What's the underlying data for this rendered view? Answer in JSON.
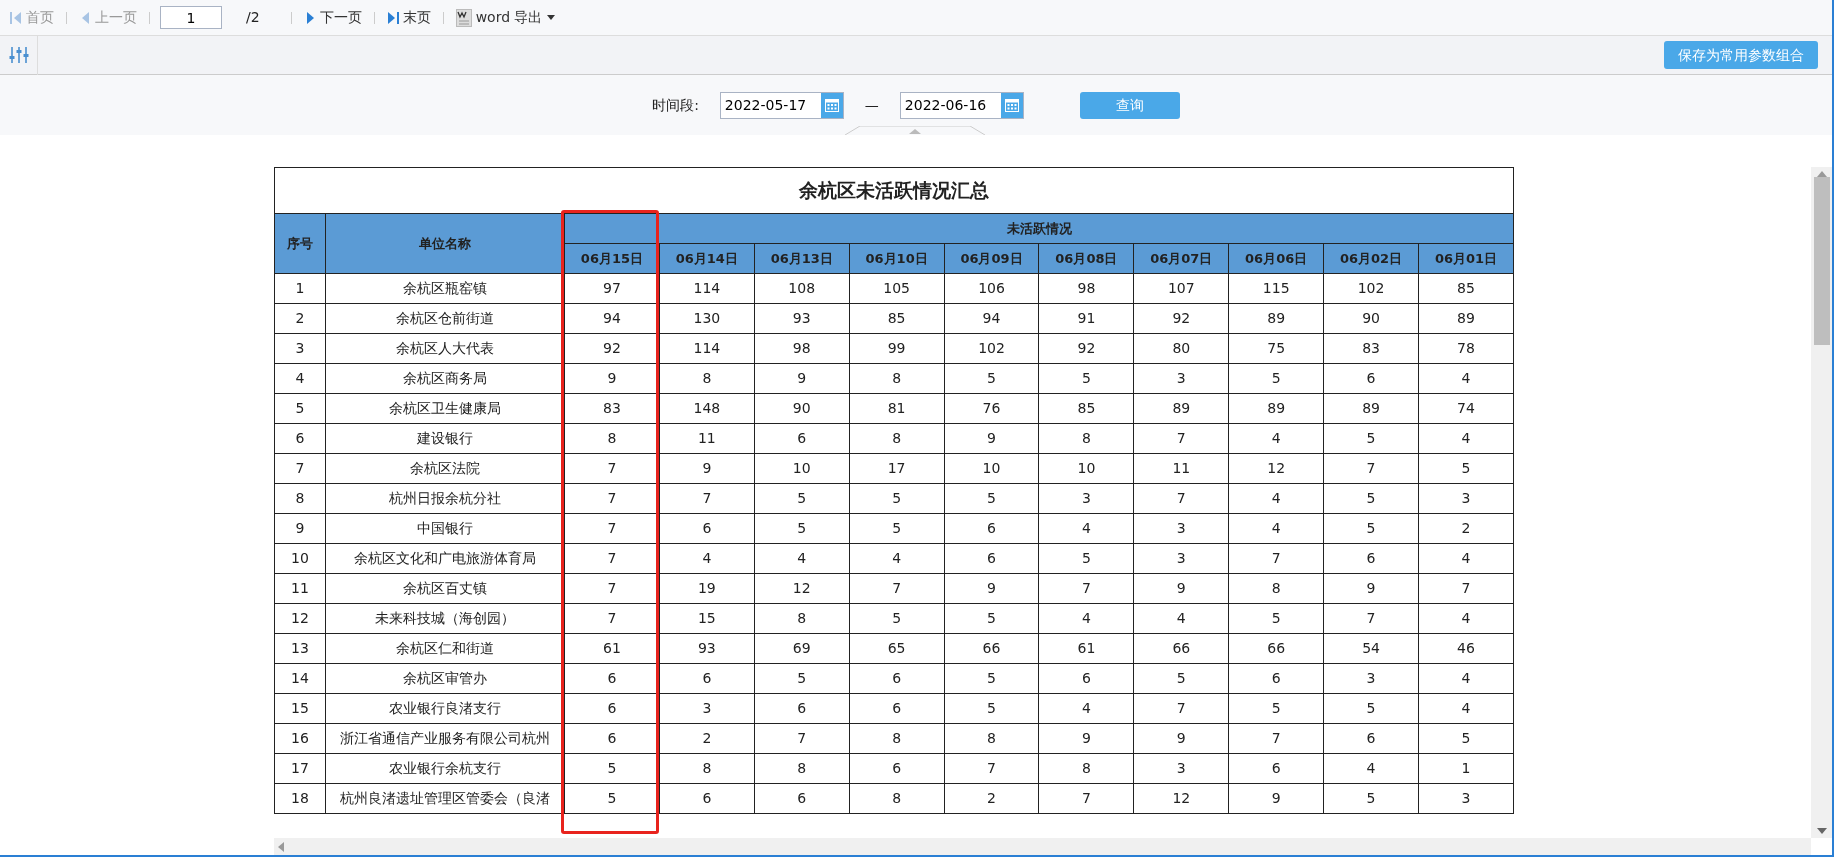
{
  "toolbar": {
    "items": [
      {
        "kind": "first",
        "label": "首页",
        "disabled": true
      },
      {
        "kind": "prev",
        "label": "上一页",
        "disabled": true
      },
      {
        "kind": "page",
        "value": "1",
        "total": "/2"
      },
      {
        "kind": "next",
        "label": "下一页",
        "disabled": false
      },
      {
        "kind": "last",
        "label": "末页",
        "disabled": false
      },
      {
        "kind": "export",
        "label": "word 导出"
      }
    ]
  },
  "params": {
    "save_button": "保存为常用参数组合",
    "period_label": "时间段:",
    "start_date": "2022-05-17",
    "separator": "—",
    "end_date": "2022-06-16",
    "query_button": "查询"
  },
  "report": {
    "title": "余杭区未活跃情况汇总",
    "columns": {
      "index": "序号",
      "name": "单位名称",
      "group": "未活跃情况",
      "dates": [
        {
          "label": "06月15日",
          "highlighted": true
        },
        {
          "label": "06月14日",
          "highlighted": false
        },
        {
          "label": "06月13日",
          "highlighted": false
        },
        {
          "label": "06月10日",
          "highlighted": false
        },
        {
          "label": "06月09日",
          "highlighted": false
        },
        {
          "label": "06月08日",
          "highlighted": false
        },
        {
          "label": "06月07日",
          "highlighted": false
        },
        {
          "label": "06月06日",
          "highlighted": false
        },
        {
          "label": "06月02日",
          "highlighted": false
        },
        {
          "label": "06月01日",
          "highlighted": false
        }
      ]
    },
    "rows": [
      {
        "index": "1",
        "name": "余杭区瓶窑镇",
        "values": [
          "97",
          "114",
          "108",
          "105",
          "106",
          "98",
          "107",
          "115",
          "102",
          "85"
        ]
      },
      {
        "index": "2",
        "name": "余杭区仓前街道",
        "values": [
          "94",
          "130",
          "93",
          "85",
          "94",
          "91",
          "92",
          "89",
          "90",
          "89"
        ]
      },
      {
        "index": "3",
        "name": "余杭区人大代表",
        "values": [
          "92",
          "114",
          "98",
          "99",
          "102",
          "92",
          "80",
          "75",
          "83",
          "78"
        ]
      },
      {
        "index": "4",
        "name": "余杭区商务局",
        "values": [
          "9",
          "8",
          "9",
          "8",
          "5",
          "5",
          "3",
          "5",
          "6",
          "4"
        ]
      },
      {
        "index": "5",
        "name": "余杭区卫生健康局",
        "values": [
          "83",
          "148",
          "90",
          "81",
          "76",
          "85",
          "89",
          "89",
          "89",
          "74"
        ]
      },
      {
        "index": "6",
        "name": "建设银行",
        "values": [
          "8",
          "11",
          "6",
          "8",
          "9",
          "8",
          "7",
          "4",
          "5",
          "4"
        ]
      },
      {
        "index": "7",
        "name": "余杭区法院",
        "values": [
          "7",
          "9",
          "10",
          "17",
          "10",
          "10",
          "11",
          "12",
          "7",
          "5"
        ]
      },
      {
        "index": "8",
        "name": "杭州日报余杭分社",
        "values": [
          "7",
          "7",
          "5",
          "5",
          "5",
          "3",
          "7",
          "4",
          "5",
          "3"
        ]
      },
      {
        "index": "9",
        "name": "中国银行",
        "values": [
          "7",
          "6",
          "5",
          "5",
          "6",
          "4",
          "3",
          "4",
          "5",
          "2"
        ]
      },
      {
        "index": "10",
        "name": "余杭区文化和广电旅游体育局",
        "values": [
          "7",
          "4",
          "4",
          "4",
          "6",
          "5",
          "3",
          "7",
          "6",
          "4"
        ]
      },
      {
        "index": "11",
        "name": "余杭区百丈镇",
        "values": [
          "7",
          "19",
          "12",
          "7",
          "9",
          "7",
          "9",
          "8",
          "9",
          "7"
        ]
      },
      {
        "index": "12",
        "name": "未来科技城（海创园）",
        "values": [
          "7",
          "15",
          "8",
          "5",
          "5",
          "4",
          "4",
          "5",
          "7",
          "4"
        ]
      },
      {
        "index": "13",
        "name": "余杭区仁和街道",
        "values": [
          "61",
          "93",
          "69",
          "65",
          "66",
          "61",
          "66",
          "66",
          "54",
          "46"
        ]
      },
      {
        "index": "14",
        "name": "余杭区审管办",
        "values": [
          "6",
          "6",
          "5",
          "6",
          "5",
          "6",
          "5",
          "6",
          "3",
          "4"
        ]
      },
      {
        "index": "15",
        "name": "农业银行良渚支行",
        "values": [
          "6",
          "3",
          "6",
          "6",
          "5",
          "4",
          "7",
          "5",
          "5",
          "4"
        ]
      },
      {
        "index": "16",
        "name": "浙江省通信产业服务有限公司杭州",
        "values": [
          "6",
          "2",
          "7",
          "8",
          "8",
          "9",
          "9",
          "7",
          "6",
          "5"
        ]
      },
      {
        "index": "17",
        "name": "农业银行余杭支行",
        "values": [
          "5",
          "8",
          "8",
          "6",
          "7",
          "8",
          "3",
          "6",
          "4",
          "1"
        ]
      },
      {
        "index": "18",
        "name": "杭州良渚遗址管理区管委会（良渚",
        "values": [
          "5",
          "6",
          "6",
          "8",
          "2",
          "7",
          "12",
          "9",
          "5",
          "3"
        ]
      }
    ]
  }
}
